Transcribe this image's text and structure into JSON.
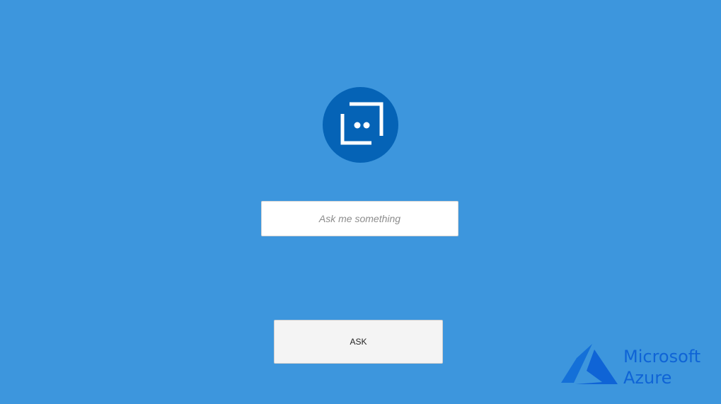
{
  "app": {
    "logo_icon": "bot-framework-chat-icon",
    "background_color": "#3d96dd",
    "logo_color": "#0563b6"
  },
  "question_input": {
    "value": "",
    "placeholder": "Ask me something"
  },
  "ask_button": {
    "label": "ASK"
  },
  "brand": {
    "icon": "azure-logo-icon",
    "line1": "Microsoft",
    "line2": "Azure",
    "color": "#0f64d6"
  }
}
